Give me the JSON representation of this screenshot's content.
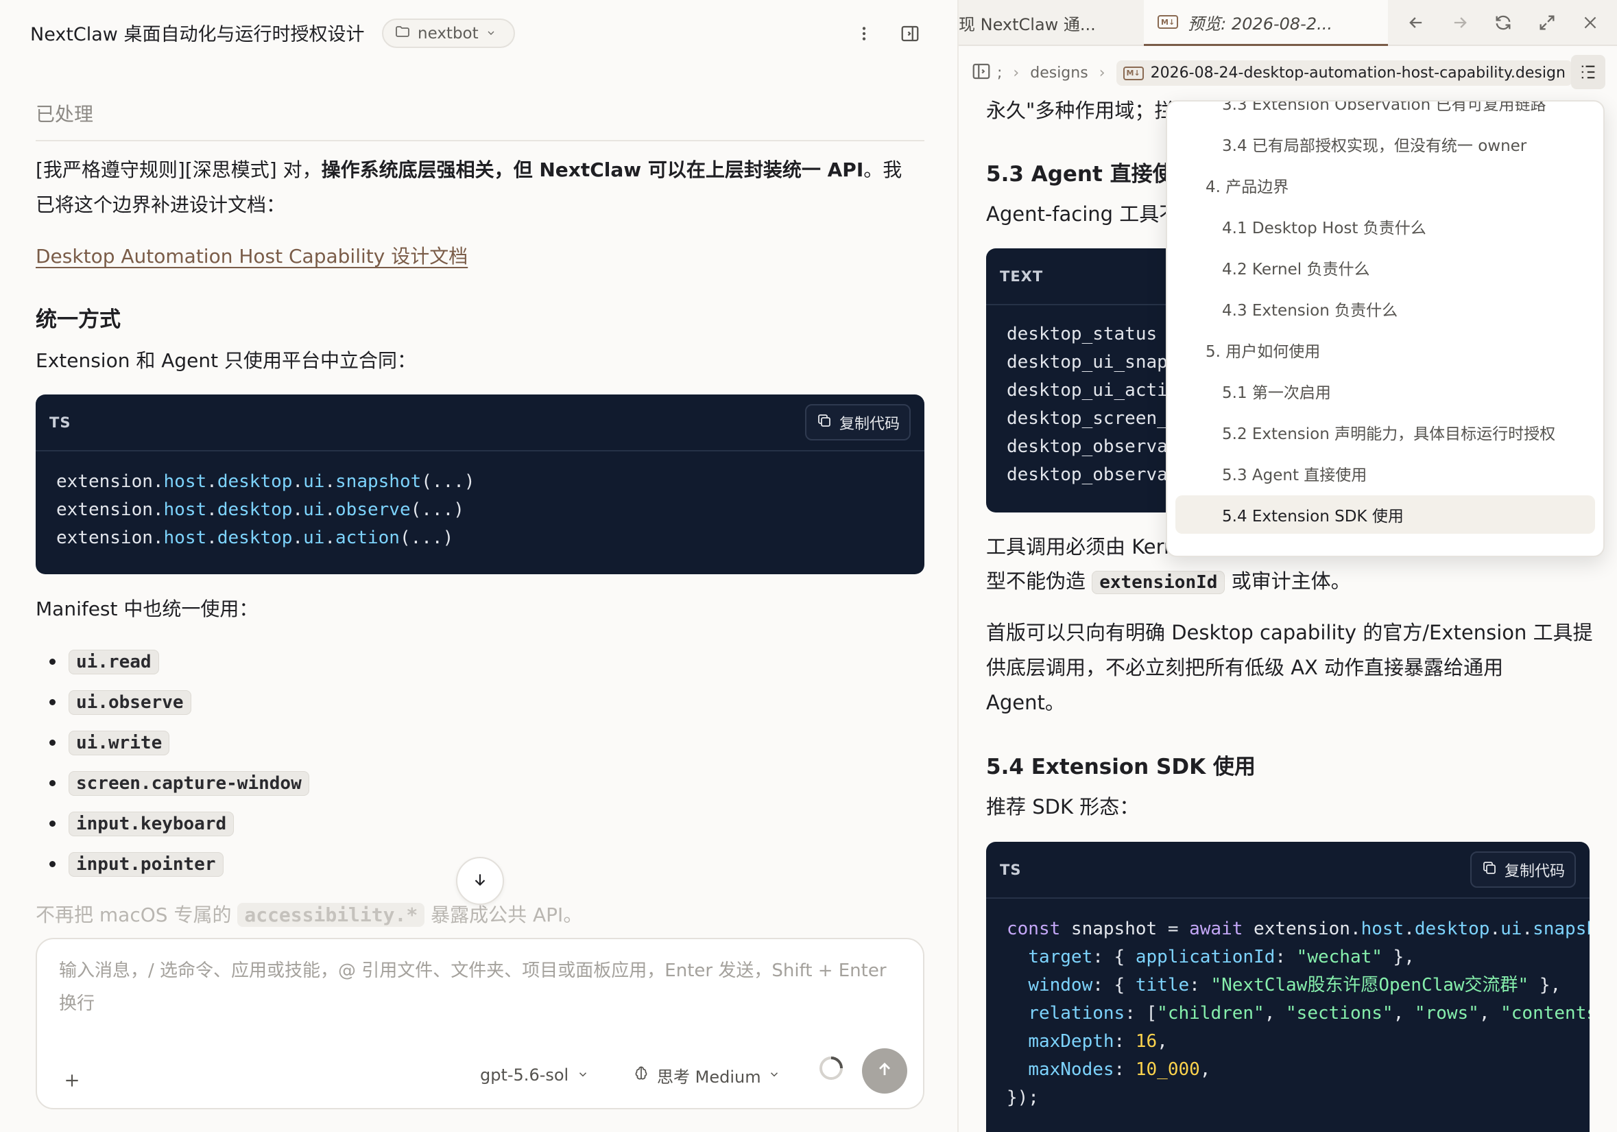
{
  "header": {
    "title": "NextClaw 桌面自动化与运行时授权设计",
    "project_name": "nextbot"
  },
  "chat": {
    "processed_label": "已处理",
    "intro_prefix": "[我严格遵守规则][深思模式] 对，",
    "intro_bold": "操作系统底层强相关，但 NextClaw 可以在上层封装统一 API",
    "intro_suffix_line1": "。我",
    "intro_line2": "已将这个边界补进设计文档：",
    "doc_link": "Desktop Automation Host Capability 设计文档",
    "section_heading": "统一方式",
    "contract_text": "Extension 和 Agent 只使用平台中立合同：",
    "code1": {
      "lang": "TS",
      "copy_label": "复制代码",
      "lines": [
        [
          "extension.",
          "host",
          ".",
          "desktop",
          ".",
          "ui",
          ".",
          "snapshot",
          "(...)"
        ],
        [
          "extension.",
          "host",
          ".",
          "desktop",
          ".",
          "ui",
          ".",
          "observe",
          "(...)"
        ],
        [
          "extension.",
          "host",
          ".",
          "desktop",
          ".",
          "ui",
          ".",
          "action",
          "(...)"
        ]
      ]
    },
    "manifest_text": "Manifest 中也统一使用：",
    "permissions": [
      "ui.read",
      "ui.observe",
      "ui.write",
      "screen.capture-window",
      "input.keyboard",
      "input.pointer"
    ],
    "faded_prefix": "不再把 macOS 专属的 ",
    "faded_code": "accessibility.*",
    "faded_suffix": " 暴露成公共 API。"
  },
  "composer": {
    "placeholder": "输入消息，/ 选命令、应用或技能，@ 引用文件、文件夹、项目或面板应用，Enter 发送，Shift + Enter 换行",
    "model": "gpt-5.6-sol",
    "thinking": "思考 Medium"
  },
  "preview": {
    "tabs": [
      {
        "label": "现 NextClaw 通...",
        "active": false
      },
      {
        "label": "预览: 2026-08-2...",
        "active": true,
        "badge": "M↓"
      }
    ],
    "breadcrumb": {
      "root": ";",
      "folder": "designs",
      "file": "2026-08-24-desktop-automation-host-capability.design",
      "badge": "M↓"
    },
    "content": {
      "top_line": "永久\"多种作用域；拦",
      "h_53": "5.3 Agent 直接使用",
      "agent_text": "Agent-facing 工具不",
      "code_tools": {
        "lang": "TEXT",
        "lines": [
          "desktop_status",
          "desktop_ui_snap",
          "desktop_ui_acti",
          "desktop_screen_",
          "desktop_observa",
          "desktop_observa"
        ]
      },
      "kernel_line1": "工具调用必须由 Kerr",
      "kernel_line2_prefix": "型不能伪造 ",
      "kernel_code": "extensionId",
      "kernel_line2_suffix": " 或审计主体。",
      "para_line1": "首版可以只向有明确 Desktop capability 的官方/Extension 工具提",
      "para_line2": "供底层调用，不必立刻把所有低级 AX 动作直接暴露给通用",
      "para_line3": "Agent。",
      "h_54": "5.4 Extension SDK 使用",
      "sdk_text": "推荐 SDK 形态：",
      "code_sdk": {
        "lang": "TS",
        "copy_label": "复制代码"
      }
    },
    "toc": {
      "items": [
        {
          "label": "3.3 Extension Observation 已有可复用链路",
          "level": 2
        },
        {
          "label": "3.4 已有局部授权实现，但没有统一 owner",
          "level": 2
        },
        {
          "label": "4. 产品边界",
          "level": 1
        },
        {
          "label": "4.1 Desktop Host 负责什么",
          "level": 2
        },
        {
          "label": "4.2 Kernel 负责什么",
          "level": 2
        },
        {
          "label": "4.3 Extension 负责什么",
          "level": 2
        },
        {
          "label": "5. 用户如何使用",
          "level": 1
        },
        {
          "label": "5.1 第一次启用",
          "level": 2
        },
        {
          "label": "5.2 Extension 声明能力，具体目标运行时授权",
          "level": 2
        },
        {
          "label": "5.3 Agent 直接使用",
          "level": 2
        },
        {
          "label": "5.4 Extension SDK 使用",
          "level": 2,
          "active": true
        }
      ]
    }
  },
  "icons": {
    "folder": "folder-icon",
    "more": "more-vertical-icon",
    "panel": "panel-toggle-icon",
    "copy": "copy-icon",
    "arrow_down": "arrow-down-icon",
    "plus": "plus-icon",
    "brain": "brain-icon",
    "send": "arrow-up-icon",
    "back": "arrow-left-icon",
    "forward": "arrow-right-icon",
    "refresh": "refresh-icon",
    "expand": "expand-icon",
    "close": "close-icon",
    "toc": "toc-list-icon"
  },
  "colors": {
    "accent_link": "#7a5c48",
    "code_bg": "#111b2e",
    "send_button": "#a8a5a0"
  }
}
